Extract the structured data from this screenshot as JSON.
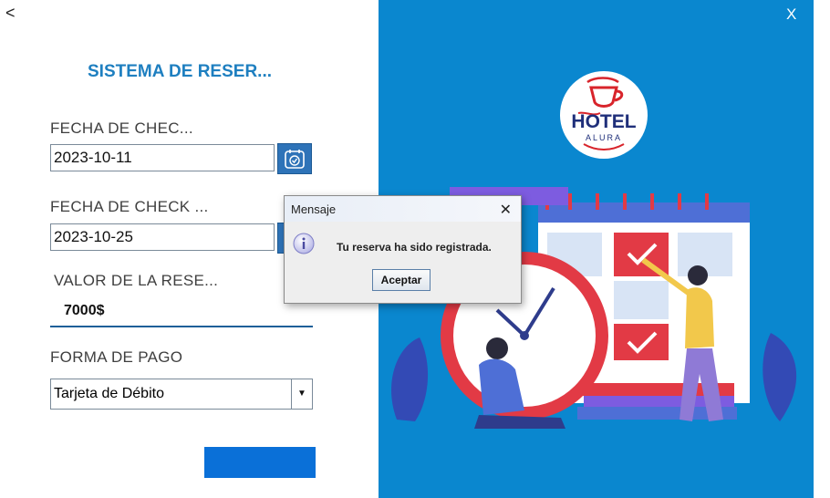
{
  "nav": {
    "back": "<",
    "close": "X"
  },
  "form": {
    "title": "SISTEMA DE RESER...",
    "checkin_label": "FECHA DE CHEC...",
    "checkin_value": "2023-10-11",
    "checkout_label": "FECHA DE CHECK ...",
    "checkout_value": "2023-10-25",
    "valor_label": "VALOR DE LA RESE...",
    "valor_value": "7000$",
    "pago_label": "FORMA DE PAGO",
    "pago_value": "Tarjeta de Débito",
    "submit_label": ""
  },
  "logo": {
    "text_main": "HOTEL",
    "text_sub": "ALURA"
  },
  "dialog": {
    "title": "Mensaje",
    "close": "✕",
    "message": "Tu reserva ha sido registrada.",
    "ok": "Aceptar",
    "icon": "info-icon"
  },
  "colors": {
    "panel_blue": "#0a87cf",
    "title_blue": "#1e7fc0",
    "button_blue": "#0a70d8"
  }
}
